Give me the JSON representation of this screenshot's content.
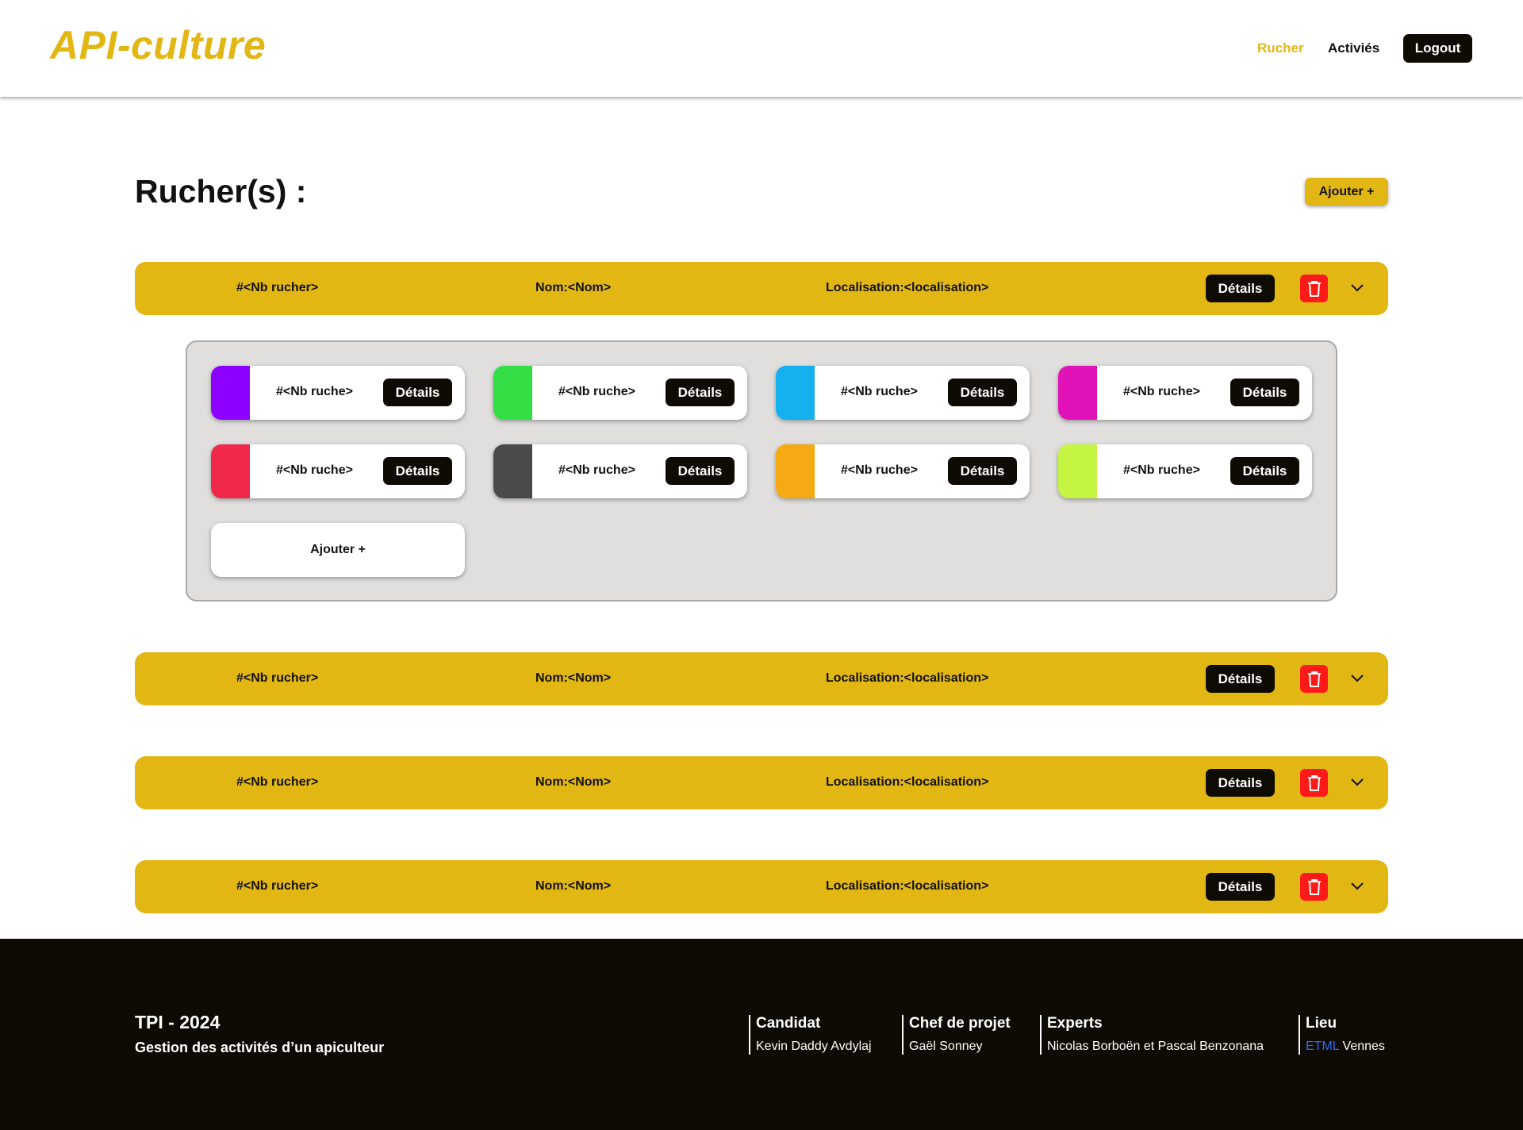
{
  "header": {
    "logo": "API-culture",
    "nav": {
      "rucher": "Rucher",
      "activites": "Activiés"
    },
    "logout_label": "Logout",
    "accent_color": "#e2b714"
  },
  "main": {
    "title": "Rucher(s) :",
    "add_label": "Ajouter +",
    "ruchers": [
      {
        "num": "#<Nb rucher>",
        "nom": "Nom:<Nom>",
        "localisation": "Localisation:<localisation>",
        "details_label": "Détails",
        "expanded": true
      },
      {
        "num": "#<Nb rucher>",
        "nom": "Nom:<Nom>",
        "localisation": "Localisation:<localisation>",
        "details_label": "Détails",
        "expanded": false
      },
      {
        "num": "#<Nb rucher>",
        "nom": "Nom:<Nom>",
        "localisation": "Localisation:<localisation>",
        "details_label": "Détails",
        "expanded": false
      },
      {
        "num": "#<Nb rucher>",
        "nom": "Nom:<Nom>",
        "localisation": "Localisation:<localisation>",
        "details_label": "Détails",
        "expanded": false
      }
    ],
    "ruches": [
      {
        "label": "#<Nb ruche>",
        "details_label": "Détails",
        "color": "#8c00ff"
      },
      {
        "label": "#<Nb ruche>",
        "details_label": "Détails",
        "color": "#33dd44"
      },
      {
        "label": "#<Nb ruche>",
        "details_label": "Détails",
        "color": "#14b0f0"
      },
      {
        "label": "#<Nb ruche>",
        "details_label": "Détails",
        "color": "#e012b8"
      },
      {
        "label": "#<Nb ruche>",
        "details_label": "Détails",
        "color": "#f0284a"
      },
      {
        "label": "#<Nb ruche>",
        "details_label": "Détails",
        "color": "#4a4a4a"
      },
      {
        "label": "#<Nb ruche>",
        "details_label": "Détails",
        "color": "#f5aa14"
      },
      {
        "label": "#<Nb ruche>",
        "details_label": "Détails",
        "color": "#c3f542"
      }
    ],
    "add_ruche_label": "Ajouter +"
  },
  "footer": {
    "title": "TPI - 2024",
    "subtitle": "Gestion des activités d’un apiculteur",
    "candidat": {
      "heading": "Candidat",
      "value": "Kevin Daddy Avdylaj"
    },
    "chef": {
      "heading": "Chef de projet",
      "value": "Gaël Sonney"
    },
    "experts": {
      "heading": "Experts",
      "value": "Nicolas Borboën et Pascal Benzonana"
    },
    "lieu": {
      "heading": "Lieu",
      "etml": "ETML",
      "city": "Vennes"
    }
  }
}
